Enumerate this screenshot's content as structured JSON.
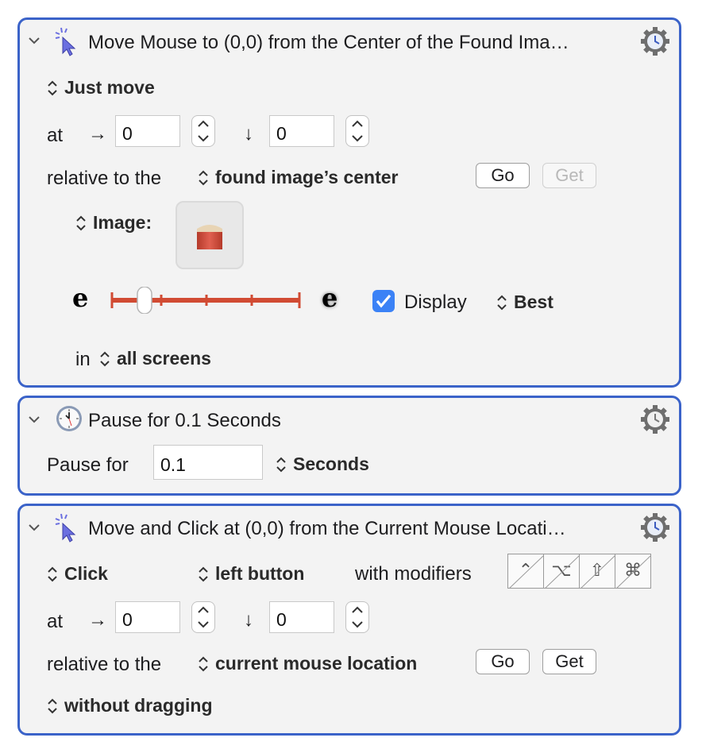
{
  "actions": [
    {
      "title": "Move Mouse to (0,0) from the Center of the Found Ima…",
      "mode": "Just move",
      "at_label": "at",
      "x": "0",
      "y": "0",
      "relative_label": "relative to the",
      "relative_value": "found image’s center",
      "go": "Go",
      "get": "Get",
      "image_label": "Image:",
      "fuzz_left": "e",
      "fuzz_right": "e",
      "display_label": "Display",
      "display_checked": true,
      "quality": "Best",
      "in_label": "in",
      "screens": "all screens"
    },
    {
      "title": "Pause for 0.1 Seconds",
      "pause_label": "Pause for",
      "pause_value": "0.1",
      "unit": "Seconds"
    },
    {
      "title": "Move and Click at (0,0) from the Current Mouse Locati…",
      "mode": "Click",
      "button": "left button",
      "modifiers_label": "with modifiers",
      "modifiers": [
        "⌃",
        "⌥",
        "⇧",
        "⌘"
      ],
      "at_label": "at",
      "x": "0",
      "y": "0",
      "relative_label": "relative to the",
      "relative_value": "current mouse location",
      "go": "Go",
      "get": "Get",
      "drag": "without dragging"
    }
  ],
  "icons": {
    "collapse": "chevron-down-icon",
    "click": "cursor-click-icon",
    "clock": "clock-icon",
    "gear": "gear-clock-icon",
    "arrow_right": "→",
    "arrow_down": "↓"
  },
  "colors": {
    "panel_border": "#3b63c9",
    "slider": "#d14b33",
    "checkbox": "#3b82f6"
  }
}
